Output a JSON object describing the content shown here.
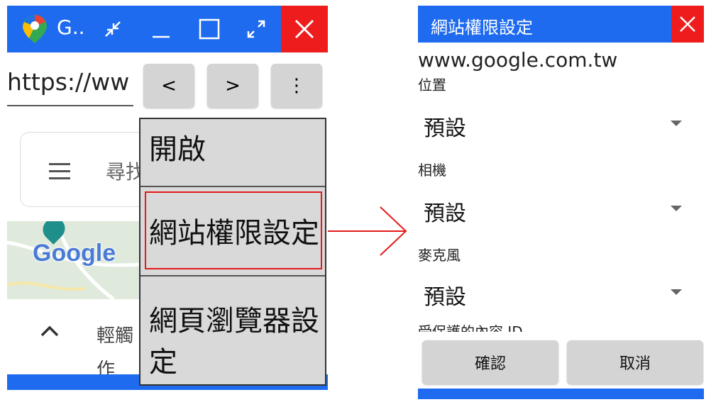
{
  "colors": {
    "titlebar": "#1e6bf0",
    "close": "#ee1c1c",
    "highlight": "#e31b1b",
    "menu_bg": "#d9d9d9",
    "button_bg": "#d4d4d4"
  },
  "left_window": {
    "title": "G..",
    "icons": {
      "logo": "google-maps-icon",
      "shrink": "shrink-icon",
      "minimize": "minimize-icon",
      "maximize": "maximize-icon",
      "expand": "expand-icon",
      "close": "close-icon"
    },
    "url": "https://ww",
    "nav": {
      "back": "<",
      "forward": ">",
      "more": "⋮"
    },
    "search_hint": "尋找",
    "map_watermark": "Google",
    "bottom_text": "輕觸\n作",
    "menu": [
      "開啟",
      "網站權限設定",
      "網頁瀏覽器設定"
    ]
  },
  "right_dialog": {
    "title": "網站權限設定",
    "domain": "www.google.com.tw",
    "permissions": [
      {
        "label": "位置",
        "value": "預設"
      },
      {
        "label": "相機",
        "value": "預設"
      },
      {
        "label": "麥克風",
        "value": "預設"
      }
    ],
    "cut_label": "受保護的內容 ID",
    "confirm": "確認",
    "cancel": "取消"
  }
}
